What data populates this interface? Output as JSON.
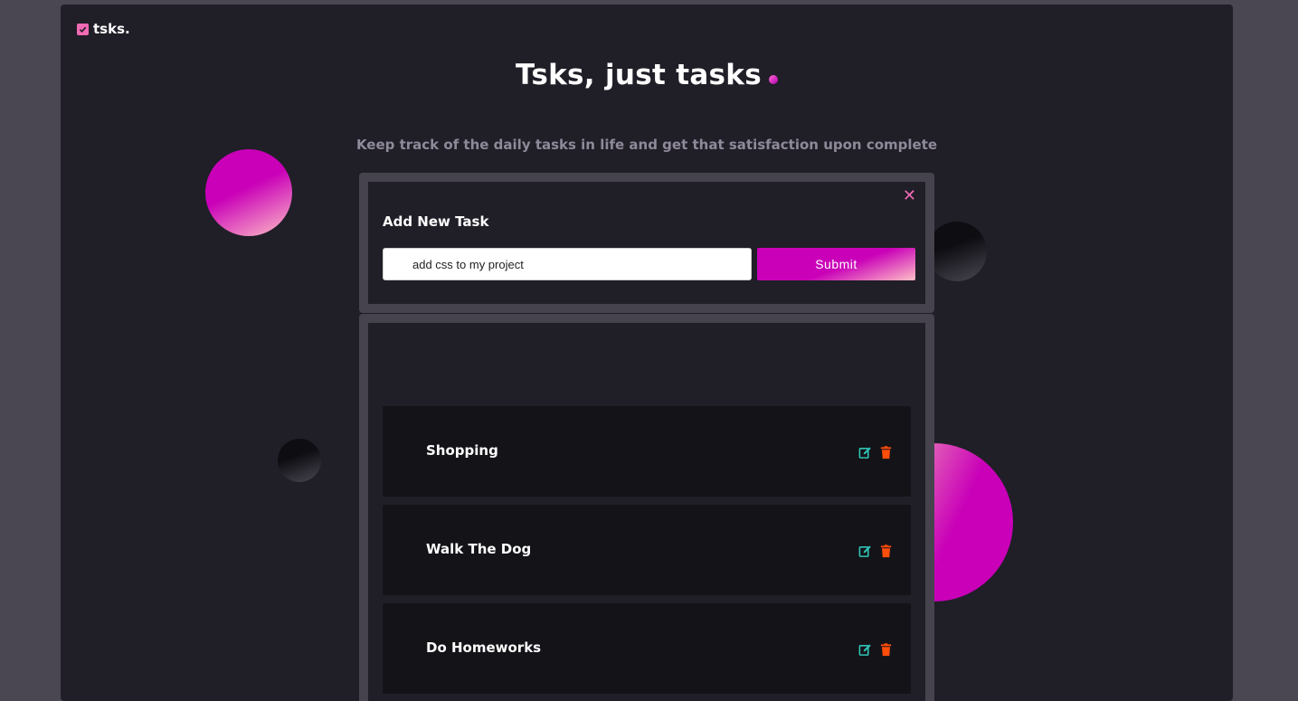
{
  "brand": {
    "name": "tsks."
  },
  "header": {
    "title": "Tsks, just tasks",
    "subtitle": "Keep track of the daily tasks in life and get that satisfaction upon complete"
  },
  "add_task": {
    "title": "Add New Task",
    "close_label": "✕",
    "input_value": "add css to my project",
    "submit_label": "Submit"
  },
  "tasks": [
    {
      "name": "Shopping"
    },
    {
      "name": "Walk The Dog"
    },
    {
      "name": "Do Homeworks"
    }
  ],
  "colors": {
    "accent": "#c900b8",
    "accent_light": "#ffc0c6",
    "edit_icon": "#2ec4b6",
    "delete_icon": "#ff4d0a",
    "close_icon": "#f06ab4"
  },
  "icons": {
    "brand": "checkbox-icon",
    "edit": "edit-icon",
    "delete": "trash-icon",
    "close": "close-icon"
  }
}
